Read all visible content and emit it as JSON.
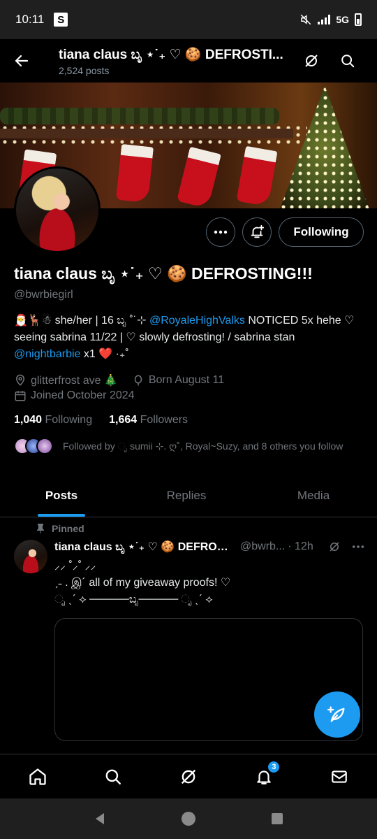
{
  "status_bar": {
    "time": "10:11",
    "app_letter": "S",
    "network": "5G"
  },
  "header": {
    "title": "tiana claus ಬೃ ⋆˙₊ ♡ 🍪 DEFROSTI...",
    "post_count": "2,524 posts"
  },
  "profile": {
    "name": "tiana claus ಬೃ ⋆˙₊ ♡ 🍪 DEFROSTING!!!",
    "handle": "@bwrbiegirl",
    "following_button": "Following",
    "bio_part1": "🎅🦌☃ she/her | 16 ಬೃ ˚˙⊹ ",
    "bio_mention1": "@RoyaleHighValks",
    "bio_part2": " NOTICED 5x hehe ♡ seeing sabrina 11/22 | ♡ slowly defrosting! / sabrina stan ",
    "bio_mention2": "@nightbarbie",
    "bio_part3": " x1 ❤️ ·₊˚",
    "location": "glitterfrost ave 🎄",
    "birthday": "Born August 11",
    "joined": "Joined October 2024",
    "following_count": "1,040",
    "following_label": "Following",
    "followers_count": "1,664",
    "followers_label": "Followers",
    "followed_by": "Followed by ೃ sumii ⊹. ღ˚, Royal~Suzy, and 8 others you follow"
  },
  "tabs": [
    "Posts",
    "Replies",
    "Media"
  ],
  "post": {
    "pinned_label": "Pinned",
    "author": "tiana claus ಬೃ ⋆˙₊ ♡ 🍪 DEFROSTING!!!",
    "handle": "@bwrb...",
    "time": "· 12h",
    "text": "⸝⸝ ˚⸝˚ ⸝⸝\nˏ˗ . இ´ all of my giveaway proofs! ♡\nೃ ˎˊ ⟡ ─────ಬೃ───── ೃ ˎˊ ⟡"
  },
  "bottom_nav": {
    "notification_badge": "3"
  },
  "colors": {
    "accent": "#1d9bf0",
    "background": "#000000",
    "muted": "#71767b",
    "border": "#2f3336"
  }
}
